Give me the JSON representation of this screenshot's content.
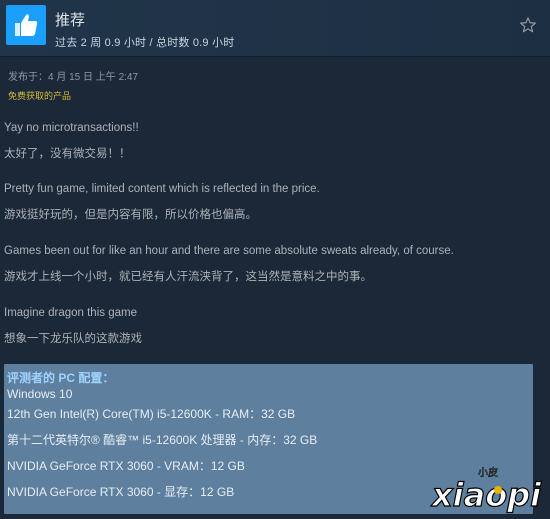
{
  "header": {
    "title": "推荐",
    "hours": "过去 2 周 0.9 小时 / 总时数 0.9 小时"
  },
  "meta": {
    "posted": "发布于：4 月 15 日 上午 2:47",
    "free_product": "免费获取的产品"
  },
  "review": {
    "lines": [
      "Yay no microtransactions!!",
      "太好了，没有微交易！！",
      "Pretty fun game, limited content which is reflected in the price.",
      "游戏挺好玩的，但是内容有限，所以价格也偏高。",
      "Games been out for like an hour and there are some absolute sweats already, of course.",
      "游戏才上线一个小时，就已经有人汗流浃背了，这当然是意料之中的事。",
      "Imagine dragon this game",
      "想象一下龙乐队的这款游戏"
    ]
  },
  "specs": {
    "label": "评测者的 PC 配置：",
    "lines": [
      "Windows 10",
      "12th Gen Intel(R) Core(TM) i5-12600K - RAM：32 GB",
      "第十二代英特尔® 酷睿™ i5-12600K 处理器 - 内存：32 GB",
      "NVIDIA GeForce RTX 3060 - VRAM：12 GB",
      "NVIDIA GeForce RTX 3060 - 显存：12 GB"
    ]
  },
  "watermark": {
    "small": "小皮",
    "big": "xiaopi",
    "dot_color": "#e8b400"
  },
  "icons": {
    "thumb": "thumbs-up-icon",
    "star": "star-outline-icon"
  },
  "colors": {
    "accent": "#1a9fff",
    "free_label": "#d6b93a",
    "spec_label": "#9fd3ff"
  }
}
